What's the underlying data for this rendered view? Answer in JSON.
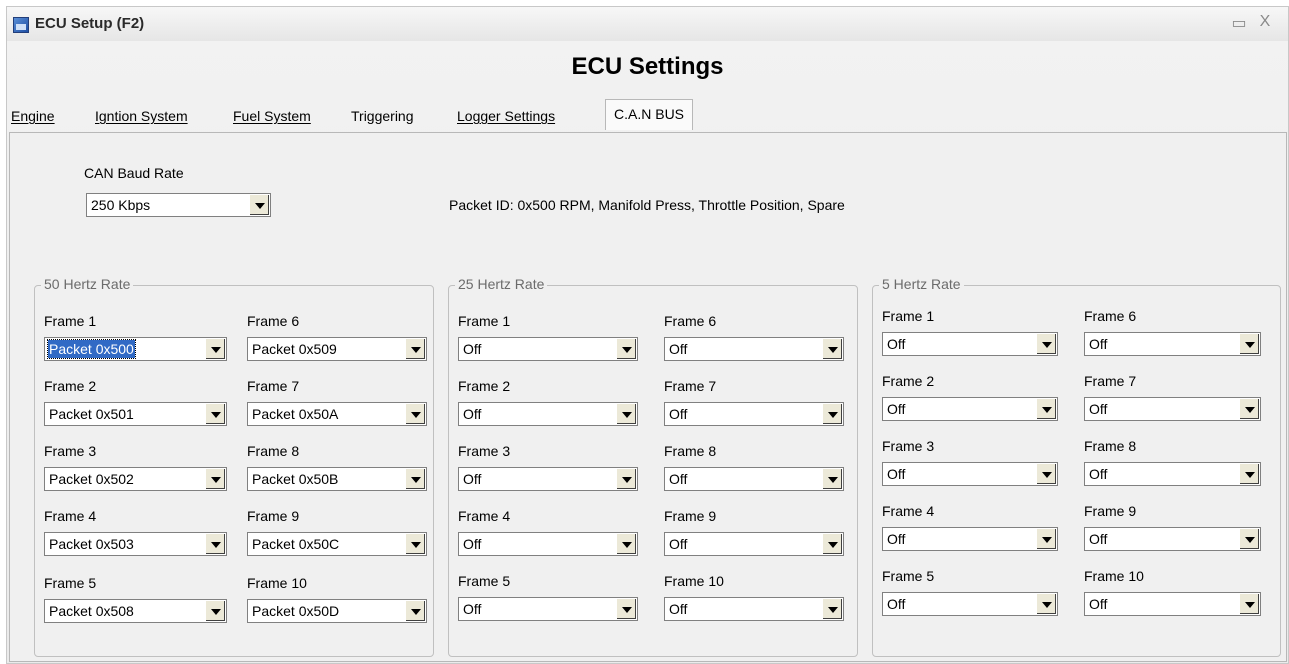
{
  "window": {
    "title": "ECU Setup (F2)",
    "minimize": "▭",
    "close": "X"
  },
  "heading": "ECU Settings",
  "tabs": [
    {
      "label": "Engine"
    },
    {
      "label": "Igntion System"
    },
    {
      "label": "Fuel System"
    },
    {
      "label": "Triggering"
    },
    {
      "label": "Logger Settings"
    },
    {
      "label": "C.A.N BUS"
    }
  ],
  "can": {
    "baud_label": "CAN Baud Rate",
    "baud_value": "250  Kbps",
    "packet_info": "Packet ID: 0x500   RPM,  Manifold Press,  Throttle Position,  Spare"
  },
  "groups": [
    {
      "title": "50 Hertz Rate",
      "frames": [
        {
          "label": "Frame 1",
          "value": "Packet  0x500"
        },
        {
          "label": "Frame 2",
          "value": "Packet  0x501"
        },
        {
          "label": "Frame 3",
          "value": "Packet  0x502"
        },
        {
          "label": "Frame 4",
          "value": "Packet  0x503"
        },
        {
          "label": "Frame 5",
          "value": "Packet  0x508"
        },
        {
          "label": "Frame 6",
          "value": "Packet  0x509"
        },
        {
          "label": "Frame 7",
          "value": "Packet  0x50A"
        },
        {
          "label": "Frame 8",
          "value": "Packet  0x50B"
        },
        {
          "label": "Frame 9",
          "value": "Packet  0x50C"
        },
        {
          "label": "Frame 10",
          "value": "Packet  0x50D"
        }
      ]
    },
    {
      "title": "25 Hertz Rate",
      "frames": [
        {
          "label": "Frame 1",
          "value": "Off"
        },
        {
          "label": "Frame 2",
          "value": "Off"
        },
        {
          "label": "Frame 3",
          "value": "Off"
        },
        {
          "label": "Frame 4",
          "value": "Off"
        },
        {
          "label": "Frame 5",
          "value": "Off"
        },
        {
          "label": "Frame 6",
          "value": "Off"
        },
        {
          "label": "Frame 7",
          "value": "Off"
        },
        {
          "label": "Frame 8",
          "value": "Off"
        },
        {
          "label": "Frame 9",
          "value": "Off"
        },
        {
          "label": "Frame 10",
          "value": "Off"
        }
      ]
    },
    {
      "title": "5 Hertz Rate",
      "frames": [
        {
          "label": "Frame 1",
          "value": "Off"
        },
        {
          "label": "Frame 2",
          "value": "Off"
        },
        {
          "label": "Frame 3",
          "value": "Off"
        },
        {
          "label": "Frame 4",
          "value": "Off"
        },
        {
          "label": "Frame 5",
          "value": "Off"
        },
        {
          "label": "Frame 6",
          "value": "Off"
        },
        {
          "label": "Frame 7",
          "value": "Off"
        },
        {
          "label": "Frame 8",
          "value": "Off"
        },
        {
          "label": "Frame 9",
          "value": "Off"
        },
        {
          "label": "Frame 10",
          "value": "Off"
        }
      ]
    }
  ]
}
